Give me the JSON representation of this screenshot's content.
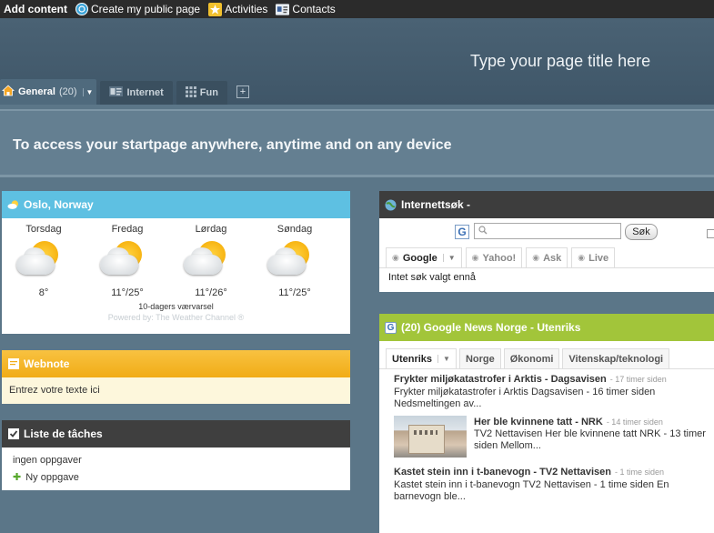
{
  "topbar": {
    "add_content": "Add content",
    "items": [
      {
        "label": "Create my public page",
        "icon": "globe-icon"
      },
      {
        "label": "Activities",
        "icon": "star-icon"
      },
      {
        "label": "Contacts",
        "icon": "contact-card-icon"
      }
    ]
  },
  "header": {
    "page_title": "Type your page title here"
  },
  "tabs": {
    "items": [
      {
        "label": "General",
        "count": "(20)",
        "icon": "home-icon"
      },
      {
        "label": "Internet",
        "icon": "web-icon"
      },
      {
        "label": "Fun",
        "icon": "grid-icon"
      }
    ],
    "add_label": "+"
  },
  "promo": {
    "text": "To access your startpage anywhere, anytime and on any device"
  },
  "weather": {
    "title": "Oslo, Norway",
    "days": [
      {
        "name": "Torsdag",
        "temp": "8°",
        "icon": "sun-cloud-icon"
      },
      {
        "name": "Fredag",
        "temp": "11°/25°",
        "icon": "sun-cloud-icon"
      },
      {
        "name": "Lørdag",
        "temp": "11°/26°",
        "icon": "sun-cloud-icon"
      },
      {
        "name": "Søndag",
        "temp": "11°/25°",
        "icon": "sun-cloud-icon"
      }
    ],
    "forecast_note": "10-dagers værvarsel",
    "powered_by": "Powered by: The Weather Channel ®"
  },
  "webnote": {
    "title": "Webnote",
    "text": "Entrez votre texte ici"
  },
  "tasks": {
    "title": "Liste de tâches",
    "empty_text": "ingen oppgaver",
    "add_label": "Ny oppgave"
  },
  "search": {
    "title": "Internettsøk -",
    "logo": "G",
    "button_label": "Søk",
    "tabs": [
      "Google",
      "Yahoo!",
      "Ask",
      "Live"
    ],
    "result": "Intet søk valgt ennå"
  },
  "news": {
    "title": "(20) Google News Norge - Utenriks",
    "tabs": [
      "Utenriks",
      "Norge",
      "Økonomi",
      "Vitenskap/teknologi"
    ],
    "items": [
      {
        "title": "Frykter miljøkatastrofer i Arktis - Dagsavisen",
        "time": "- 17 timer siden",
        "body1": "Frykter miljøkatastrofer i Arktis Dagsavisen - 16 timer siden",
        "body2": "Nedsmeltingen av..."
      },
      {
        "title": "Her ble kvinnene tatt - NRK",
        "time": "- 14 timer siden",
        "body1": "TV2 Nettavisen Her ble kvinnene tatt NRK - 13 timer",
        "body2": "siden Mellom..."
      },
      {
        "title": "Kastet stein inn i t-banevogn - TV2 Nettavisen",
        "time": "- 1 time siden",
        "body1": "Kastet stein inn i t-banevogn TV2 Nettavisen - 1 time siden En",
        "body2": "barnevogn ble..."
      }
    ]
  },
  "colors": {
    "weather_header": "#5ec0e2",
    "webnote_header": "#f3b427",
    "news_header": "#a2c53a",
    "dark_header": "#3d3d3d"
  }
}
